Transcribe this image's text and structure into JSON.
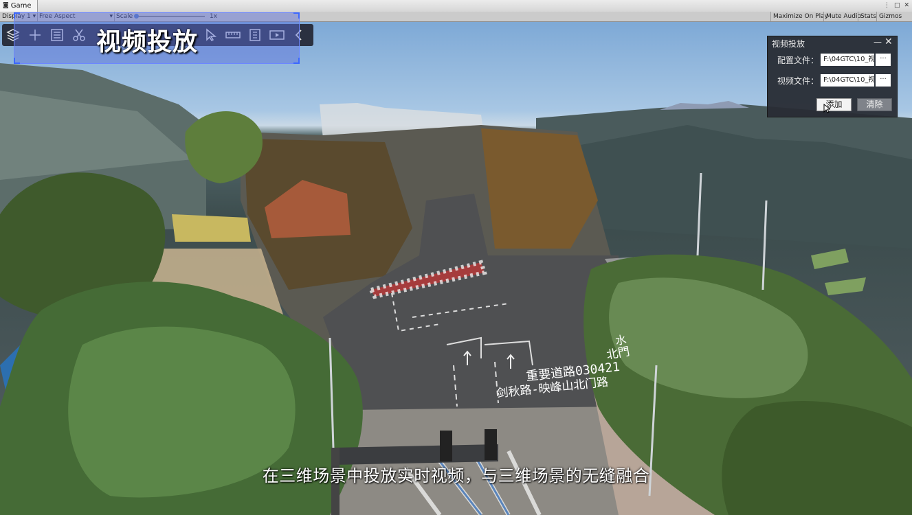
{
  "window": {
    "tab_title": "Game",
    "controls": [
      "⋮",
      "□",
      "✕"
    ]
  },
  "game_toolbar": {
    "display": "Display 1",
    "aspect": "Free Aspect",
    "scale_label": "Scale",
    "scale_value": "1x",
    "right_buttons": [
      "Maximize On Play",
      "Mute Audio",
      "Stats",
      "Gizmos"
    ]
  },
  "tool_strip": {
    "icons": [
      "layers-icon",
      "plus-icon",
      "list-icon",
      "scissors-icon",
      "cursor-icon",
      "ruler-icon",
      "document-icon",
      "video-icon",
      "chevron-left-icon"
    ],
    "overlay_title": "视频投放"
  },
  "dialog": {
    "title": "视频投放",
    "minimize": "—",
    "close": "✕",
    "config_label": "配置文件：",
    "config_value": "F:\\04GTC\\10_视",
    "video_label": "视频文件：",
    "video_value": "F:\\04GTC\\10_视",
    "browse": "···",
    "add_button": "添加",
    "clear_button": "清除"
  },
  "scene": {
    "road_text_1": "重要道路030421",
    "road_text_2": "剑秋路-映峰山北门路",
    "road_text_3": "水",
    "road_text_4": "北門"
  },
  "subtitle": "在三维场景中投放实时视频，与三维场景的无缝融合"
}
